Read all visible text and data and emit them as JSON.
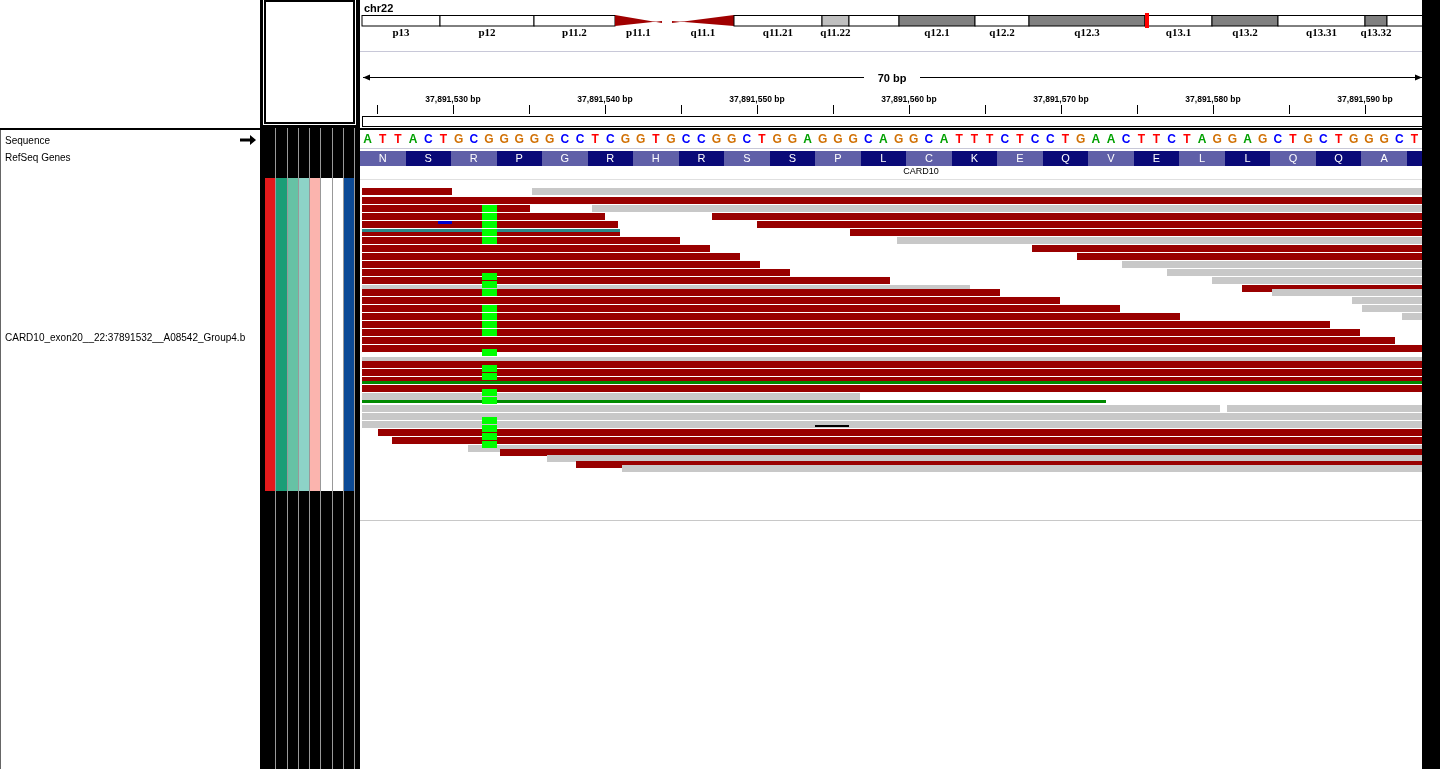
{
  "left_panel": {
    "tracks": [
      {
        "name": "Sequence",
        "kind": "sequence"
      },
      {
        "name": "RefSeq Genes",
        "kind": "genes"
      },
      {
        "name": "CARD10_exon20__22:37891532__A08542_Group4.b",
        "kind": "alignment"
      }
    ]
  },
  "attributes": [
    {
      "color": "#e31a1c"
    },
    {
      "color": "#1b9e77"
    },
    {
      "color": "#66c2a5"
    },
    {
      "color": "#8dd3c7"
    },
    {
      "color": "#fbb4ae"
    },
    {
      "color": "#ffffff"
    },
    {
      "color": "#ffffff"
    },
    {
      "color": "#0c4a96"
    }
  ],
  "ideogram": {
    "chromosome": "chr22",
    "bands": [
      {
        "label": "p13",
        "kind": "band",
        "color": "#ffffff"
      },
      {
        "label": "p12",
        "kind": "band",
        "color": "#ffffff"
      },
      {
        "label": "p11.2",
        "kind": "band",
        "color": "#ffffff"
      },
      {
        "label": "p11.1",
        "kind": "centromere",
        "color": "#a00000"
      },
      {
        "label": "q11.1",
        "kind": "centromere",
        "color": "#a00000"
      },
      {
        "label": "q11.21",
        "kind": "band",
        "color": "#ffffff"
      },
      {
        "label": "q11.22",
        "kind": "band",
        "color": "#c0c0c0"
      },
      {
        "kind": "band",
        "color": "#ffffff"
      },
      {
        "label": "q12.1",
        "kind": "band",
        "color": "#808080"
      },
      {
        "label": "q12.2",
        "kind": "band",
        "color": "#ffffff"
      },
      {
        "label": "q12.3",
        "kind": "band",
        "color": "#808080"
      },
      {
        "label": "q13.1",
        "kind": "band",
        "color": "#ffffff"
      },
      {
        "label": "q13.2",
        "kind": "band",
        "color": "#808080"
      },
      {
        "label": "q13.31",
        "kind": "band",
        "color": "#ffffff"
      },
      {
        "label": "q13.32",
        "kind": "band",
        "color": "#808080"
      },
      {
        "kind": "band",
        "color": "#ffffff"
      }
    ]
  },
  "ruler": {
    "span": "70 bp",
    "ticks": [
      "37,891,530 bp",
      "37,891,540 bp",
      "37,891,550 bp",
      "37,891,560 bp",
      "37,891,570 bp",
      "37,891,580 bp",
      "37,891,590 bp"
    ]
  },
  "sequence": [
    {
      "base": "A",
      "color": "#00a000"
    },
    {
      "base": "T",
      "color": "#ff0000"
    },
    {
      "base": "T",
      "color": "#ff0000"
    },
    {
      "base": "A",
      "color": "#00a000"
    },
    {
      "base": "C",
      "color": "#0000ff"
    },
    {
      "base": "T",
      "color": "#ff0000"
    },
    {
      "base": "G",
      "color": "#d17105"
    },
    {
      "base": "C",
      "color": "#0000ff"
    },
    {
      "base": "G",
      "color": "#d17105"
    },
    {
      "base": "G",
      "color": "#d17105"
    },
    {
      "base": "G",
      "color": "#d17105"
    },
    {
      "base": "G",
      "color": "#d17105"
    },
    {
      "base": "G",
      "color": "#d17105"
    },
    {
      "base": "C",
      "color": "#0000ff"
    },
    {
      "base": "C",
      "color": "#0000ff"
    },
    {
      "base": "T",
      "color": "#ff0000"
    },
    {
      "base": "C",
      "color": "#0000ff"
    },
    {
      "base": "G",
      "color": "#d17105"
    },
    {
      "base": "G",
      "color": "#d17105"
    },
    {
      "base": "T",
      "color": "#ff0000"
    },
    {
      "base": "G",
      "color": "#d17105"
    },
    {
      "base": "C",
      "color": "#0000ff"
    },
    {
      "base": "C",
      "color": "#0000ff"
    },
    {
      "base": "G",
      "color": "#d17105"
    },
    {
      "base": "G",
      "color": "#d17105"
    },
    {
      "base": "C",
      "color": "#0000ff"
    },
    {
      "base": "T",
      "color": "#ff0000"
    },
    {
      "base": "G",
      "color": "#d17105"
    },
    {
      "base": "G",
      "color": "#d17105"
    },
    {
      "base": "A",
      "color": "#00a000"
    },
    {
      "base": "G",
      "color": "#d17105"
    },
    {
      "base": "G",
      "color": "#d17105"
    },
    {
      "base": "G",
      "color": "#d17105"
    },
    {
      "base": "C",
      "color": "#0000ff"
    },
    {
      "base": "A",
      "color": "#00a000"
    },
    {
      "base": "G",
      "color": "#d17105"
    },
    {
      "base": "G",
      "color": "#d17105"
    },
    {
      "base": "C",
      "color": "#0000ff"
    },
    {
      "base": "A",
      "color": "#00a000"
    },
    {
      "base": "T",
      "color": "#ff0000"
    },
    {
      "base": "T",
      "color": "#ff0000"
    },
    {
      "base": "T",
      "color": "#ff0000"
    },
    {
      "base": "C",
      "color": "#0000ff"
    },
    {
      "base": "T",
      "color": "#ff0000"
    },
    {
      "base": "C",
      "color": "#0000ff"
    },
    {
      "base": "C",
      "color": "#0000ff"
    },
    {
      "base": "T",
      "color": "#ff0000"
    },
    {
      "base": "G",
      "color": "#d17105"
    },
    {
      "base": "A",
      "color": "#00a000"
    },
    {
      "base": "A",
      "color": "#00a000"
    },
    {
      "base": "C",
      "color": "#0000ff"
    },
    {
      "base": "T",
      "color": "#ff0000"
    },
    {
      "base": "T",
      "color": "#ff0000"
    },
    {
      "base": "C",
      "color": "#0000ff"
    },
    {
      "base": "T",
      "color": "#ff0000"
    },
    {
      "base": "A",
      "color": "#00a000"
    },
    {
      "base": "G",
      "color": "#d17105"
    },
    {
      "base": "G",
      "color": "#d17105"
    },
    {
      "base": "A",
      "color": "#00a000"
    },
    {
      "base": "G",
      "color": "#d17105"
    },
    {
      "base": "C",
      "color": "#0000ff"
    },
    {
      "base": "T",
      "color": "#ff0000"
    },
    {
      "base": "G",
      "color": "#d17105"
    },
    {
      "base": "C",
      "color": "#0000ff"
    },
    {
      "base": "T",
      "color": "#ff0000"
    },
    {
      "base": "G",
      "color": "#d17105"
    },
    {
      "base": "G",
      "color": "#d17105"
    },
    {
      "base": "G",
      "color": "#d17105"
    },
    {
      "base": "C",
      "color": "#0000ff"
    },
    {
      "base": "T",
      "color": "#ff0000"
    }
  ],
  "amino_acids": [
    "N",
    "S",
    "R",
    "P",
    "G",
    "R",
    "H",
    "R",
    "S",
    "S",
    "P",
    "L",
    "C",
    "K",
    "E",
    "Q",
    "V",
    "E",
    "L",
    "L",
    "Q",
    "Q",
    "A"
  ],
  "gene": {
    "name": "CARD10"
  }
}
